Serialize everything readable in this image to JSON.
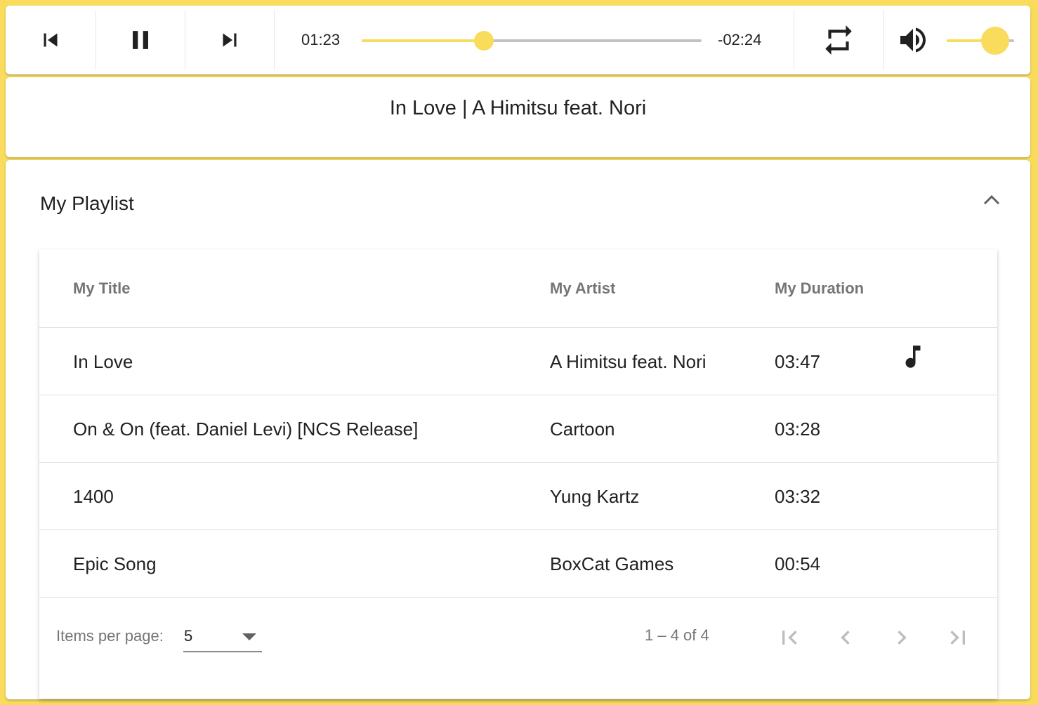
{
  "player": {
    "elapsed": "01:23",
    "remaining": "-02:24",
    "progress_fraction": 0.36,
    "volume_fraction": 0.72,
    "accent_color": "#f9dc5c",
    "icons": {
      "previous": "skip-previous-icon",
      "pause": "pause-icon",
      "next": "skip-next-icon",
      "repeat": "repeat-icon",
      "volume": "volume-up-icon"
    }
  },
  "now_playing": {
    "text": "In Love | A Himitsu feat. Nori"
  },
  "playlist": {
    "title": "My Playlist",
    "collapse_icon": "chevron-up-icon",
    "columns": {
      "title": "My Title",
      "artist": "My Artist",
      "duration": "My Duration"
    },
    "rows": [
      {
        "title": "In Love",
        "artist": "A Himitsu feat. Nori",
        "duration": "03:47",
        "playing": true
      },
      {
        "title": "On & On (feat. Daniel Levi) [NCS Release]",
        "artist": "Cartoon",
        "duration": "03:28",
        "playing": false
      },
      {
        "title": "1400",
        "artist": "Yung Kartz",
        "duration": "03:32",
        "playing": false
      },
      {
        "title": "Epic Song",
        "artist": "BoxCat Games",
        "duration": "00:54",
        "playing": false
      }
    ],
    "playing_icon": "music-note-icon"
  },
  "paginator": {
    "items_per_page_label": "Items per page:",
    "items_per_page_value": "5",
    "range_label": "1 – 4 of 4"
  }
}
